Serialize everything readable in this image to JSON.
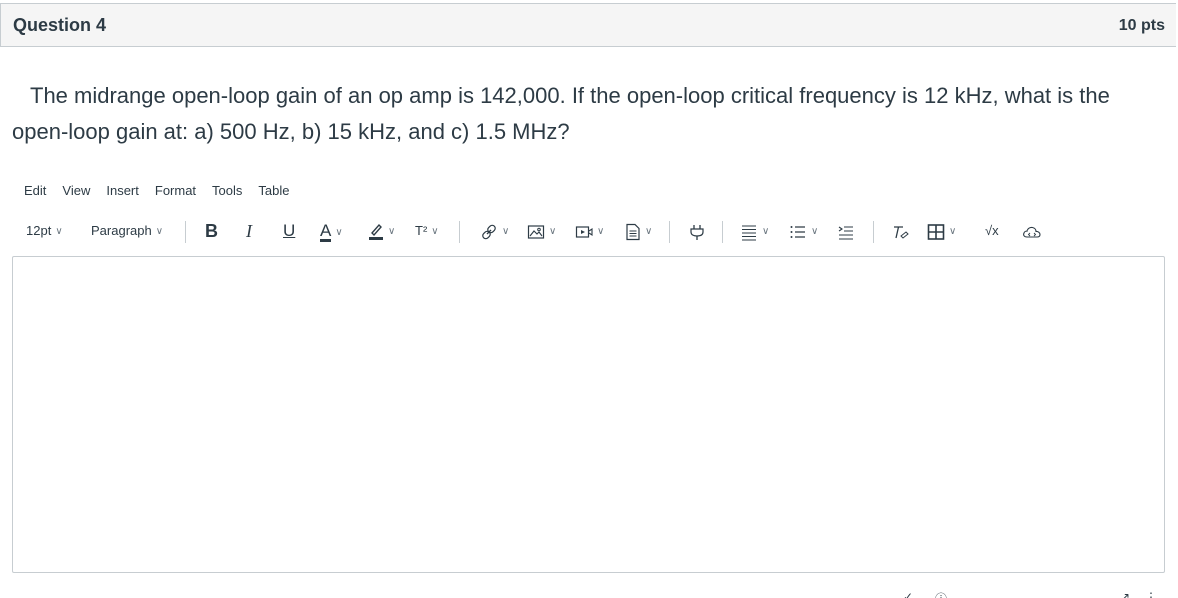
{
  "question": {
    "title": "Question 4",
    "points": "10 pts",
    "text": "The midrange open-loop gain of an op amp is 142,000.   If the open-loop critical frequency is 12 kHz, what is the open-loop gain at: a) 500 Hz, b) 15 kHz, and c) 1.5 MHz?"
  },
  "editor": {
    "menu": [
      "Edit",
      "View",
      "Insert",
      "Format",
      "Tools",
      "Table"
    ],
    "font_size": "12pt",
    "block_format": "Paragraph",
    "icons": {
      "bold": "B",
      "italic": "I",
      "underline": "U",
      "text_color": "A",
      "superscript": "T²",
      "sqrt": "√x"
    }
  }
}
